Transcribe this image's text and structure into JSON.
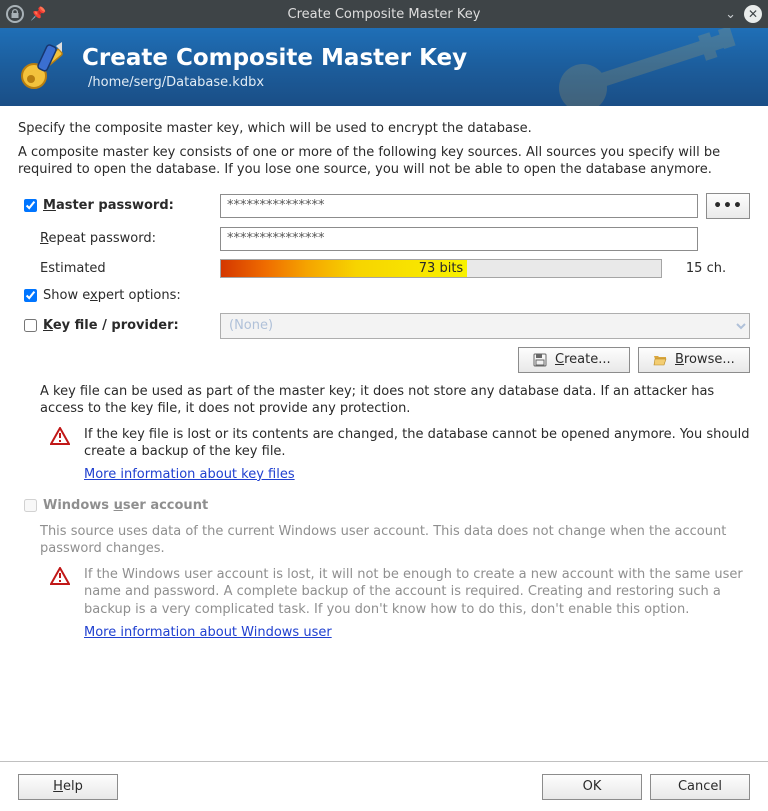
{
  "window": {
    "title": "Create Composite Master Key"
  },
  "banner": {
    "title": "Create Composite Master Key",
    "subtitle": "/home/serg/Database.kdbx"
  },
  "intro": "Specify the composite master key, which will be used to encrypt the database.",
  "subintro": "A composite master key consists of one or more of the following key sources. All sources you specify will be required to open the database. If you lose one source, you will not be able to open the database anymore.",
  "labels": {
    "master_password_pre": "M",
    "master_password_post": "aster password:",
    "repeat_password_pre": "R",
    "repeat_password_post": "epeat password:",
    "estimated": "Estimated",
    "show_expert_pre": "Show e",
    "show_expert_mid": "x",
    "show_expert_post": "pert options:",
    "keyfile_pre": "K",
    "keyfile_post": "ey file / provider:",
    "win_user_pre": "Windows ",
    "win_user_mid": "u",
    "win_user_post": "ser account"
  },
  "fields": {
    "master_password_value": "***************",
    "repeat_password_value": "***************",
    "strength_label": "73 bits",
    "char_count": "15 ch.",
    "keyfile_selected": "(None)"
  },
  "buttons": {
    "dots": "•••",
    "create_pre": "C",
    "create_post": "reate...",
    "browse_pre": "B",
    "browse_post": "rowse...",
    "help_pre": "H",
    "help_post": "elp",
    "ok": "OK",
    "cancel": "Cancel"
  },
  "keyfile_note": "A key file can be used as part of the master key; it does not store any database data. If an attacker has access to the key file, it does not provide any protection.",
  "keyfile_warning": "If the key file is lost or its contents are changed, the database cannot be opened anymore. You should create a backup of the key file.",
  "keyfile_link": "More information about key files",
  "win_note": "This source uses data of the current Windows user account. This data does not change when the account password changes.",
  "win_warning": "If the Windows user account is lost, it will not be enough to create a new account with the same user name and password. A complete backup of the account is required. Creating and restoring such a backup is a very complicated task. If you don't know how to do this, don't enable this option.",
  "win_link": "More information about Windows user"
}
